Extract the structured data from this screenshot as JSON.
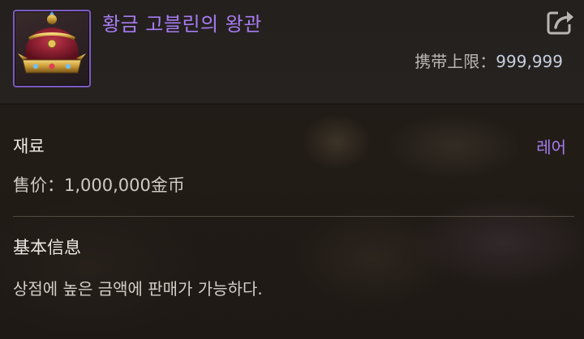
{
  "item": {
    "name": "황금 고블린의 왕관",
    "icon": "golden-crown-icon",
    "carry_limit_label": "携带上限：",
    "carry_limit_value": "999,999"
  },
  "info": {
    "category": "재료",
    "rarity": "레어",
    "sell_price": "售价：1,000,000金币"
  },
  "basic": {
    "title": "基本信息",
    "description": "상점에 높은 금액에 판매가 가능하다."
  },
  "colors": {
    "rarity_purple": "#a77cf2",
    "icon_border": "#7c5bc2",
    "background": "#221c17"
  },
  "share_icon": "share-export-icon"
}
